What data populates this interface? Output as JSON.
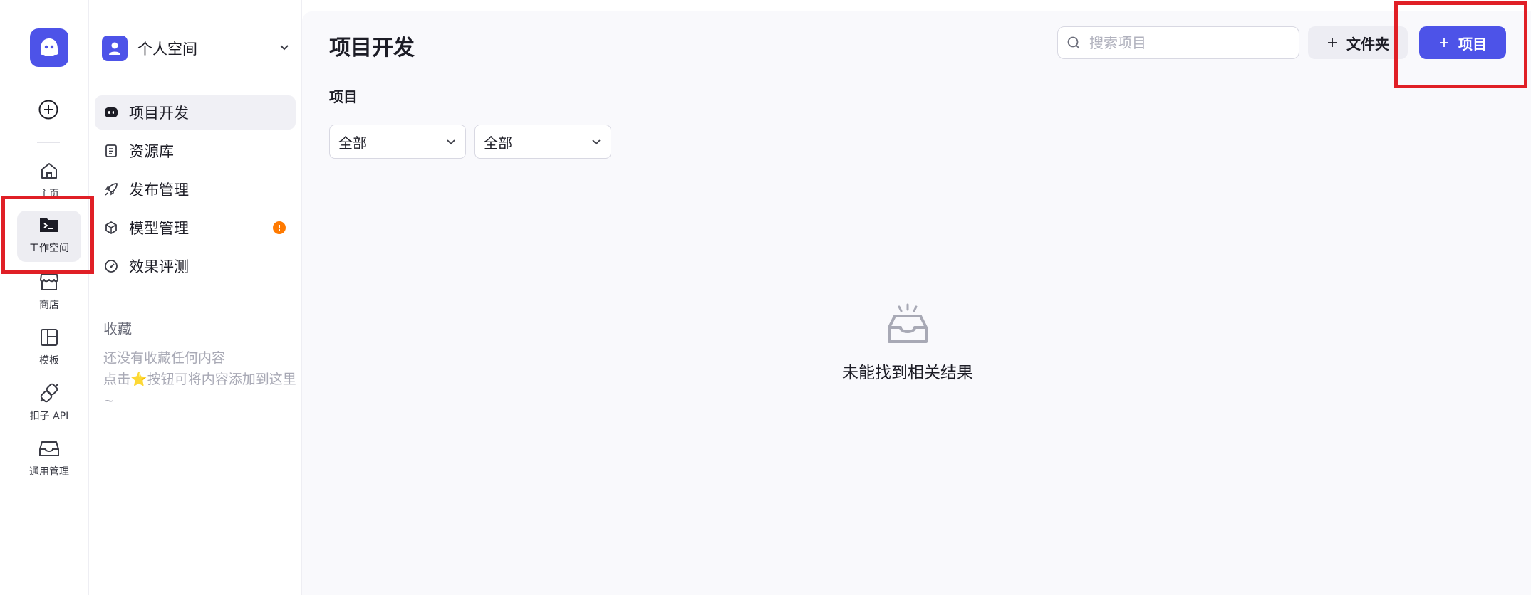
{
  "rail": {
    "create_icon": "plus-circle-icon",
    "items": [
      {
        "label": "主页",
        "icon": "home-icon"
      },
      {
        "label": "工作空间",
        "icon": "terminal-folder-icon"
      },
      {
        "label": "商店",
        "icon": "store-icon"
      },
      {
        "label": "模板",
        "icon": "template-icon"
      },
      {
        "label": "扣子 API",
        "icon": "plug-icon"
      },
      {
        "label": "通用管理",
        "icon": "inbox-icon"
      }
    ]
  },
  "sidebar": {
    "space_name": "个人空间",
    "items": [
      {
        "label": "项目开发",
        "icon": "robot-icon"
      },
      {
        "label": "资源库",
        "icon": "library-icon"
      },
      {
        "label": "发布管理",
        "icon": "rocket-icon"
      },
      {
        "label": "模型管理",
        "icon": "cube-icon",
        "badge": "!"
      },
      {
        "label": "效果评测",
        "icon": "gauge-icon"
      }
    ],
    "favorites": {
      "title": "收藏",
      "empty_line1": "还没有收藏任何内容",
      "empty_line2_prefix": "点击",
      "empty_star": "⭐",
      "empty_line2_suffix": "按钮可将内容添加到这里~"
    }
  },
  "main": {
    "title": "项目开发",
    "search_placeholder": "搜索项目",
    "folder_button": "文件夹",
    "new_project_button": "项目",
    "section_label": "项目",
    "filters": [
      "全部",
      "全部"
    ],
    "empty_text": "未能找到相关结果"
  },
  "colors": {
    "accent": "#4d53e8",
    "badge": "#ff7a00",
    "highlight": "#e01f26"
  }
}
